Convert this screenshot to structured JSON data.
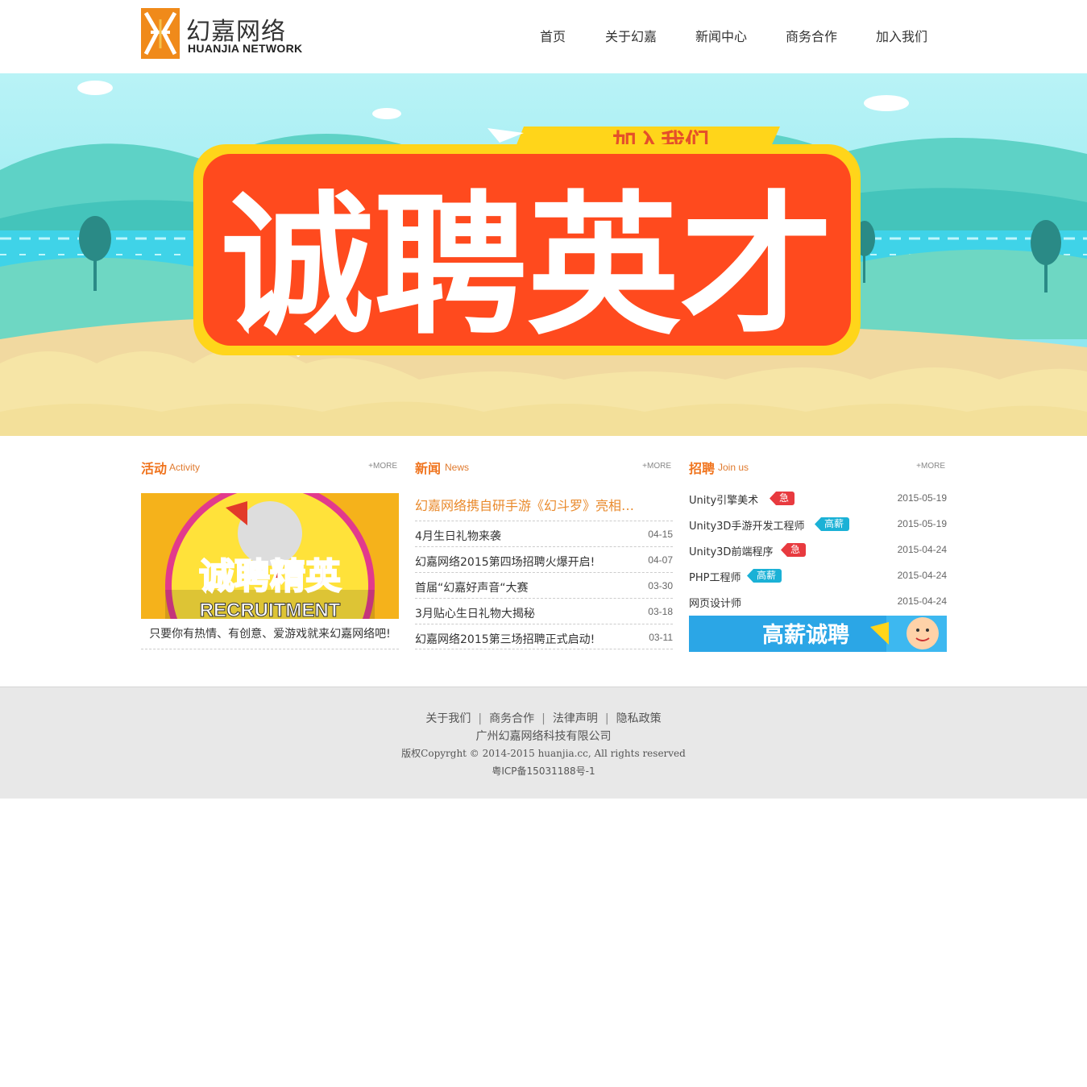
{
  "header": {
    "logo_cn": "幻嘉网络",
    "logo_en": "HUANJIA NETWORK",
    "nav": [
      "首页",
      "关于幻嘉",
      "新闻中心",
      "商务合作",
      "加入我们"
    ]
  },
  "banner": {
    "tag": "加入我们",
    "headline": "诚聘英才"
  },
  "activity": {
    "title_cn": "活动",
    "title_en": "Activity",
    "more": "+MORE",
    "image_title": "诚聘精英",
    "image_sub": "RECRUITMENT",
    "caption": "只要你有热情、有创意、爱游戏就来幻嘉网络吧!"
  },
  "news": {
    "title_cn": "新闻",
    "title_en": "News",
    "more": "+MORE",
    "headline": "幻嘉网络携自研手游《幻斗罗》亮相…",
    "items": [
      {
        "title": "4月生日礼物来袭",
        "date": "04-15"
      },
      {
        "title": "幻嘉网络2015第四场招聘火爆开启!",
        "date": "04-07"
      },
      {
        "title": "首届“幻嘉好声音“大赛",
        "date": "03-30"
      },
      {
        "title": "3月贴心生日礼物大揭秘",
        "date": "03-18"
      },
      {
        "title": "幻嘉网络2015第三场招聘正式启动!",
        "date": "03-11"
      }
    ]
  },
  "jobs": {
    "title_cn": "招聘",
    "title_en": "Join us",
    "more": "+MORE",
    "items": [
      {
        "title": "Unity引擎美术",
        "tag": "急",
        "date": "2015-05-19"
      },
      {
        "title": "Unity3D手游开发工程师",
        "tag": "高薪",
        "date": "2015-05-19"
      },
      {
        "title": "Unity3D前端程序",
        "tag": "急",
        "date": "2015-04-24"
      },
      {
        "title": "PHP工程师",
        "tag": "高薪",
        "date": "2015-04-24"
      },
      {
        "title": "网页设计师",
        "tag": "",
        "date": "2015-04-24"
      }
    ],
    "banner_text": "高薪诚聘"
  },
  "footer": {
    "links": [
      "关于我们",
      "商务合作",
      "法律声明",
      "隐私政策"
    ],
    "company": "广州幻嘉网络科技有限公司",
    "copyright": "版权Copyrght © 2014-2015 huanjia.cc, All rights reserved",
    "icp": "粤ICP备15031188号-1"
  },
  "colors": {
    "brand_orange": "#f0741e",
    "tag_red": "#e83a3f",
    "tag_blue": "#1bb1d6",
    "footer_bg": "#e8e8e8"
  }
}
